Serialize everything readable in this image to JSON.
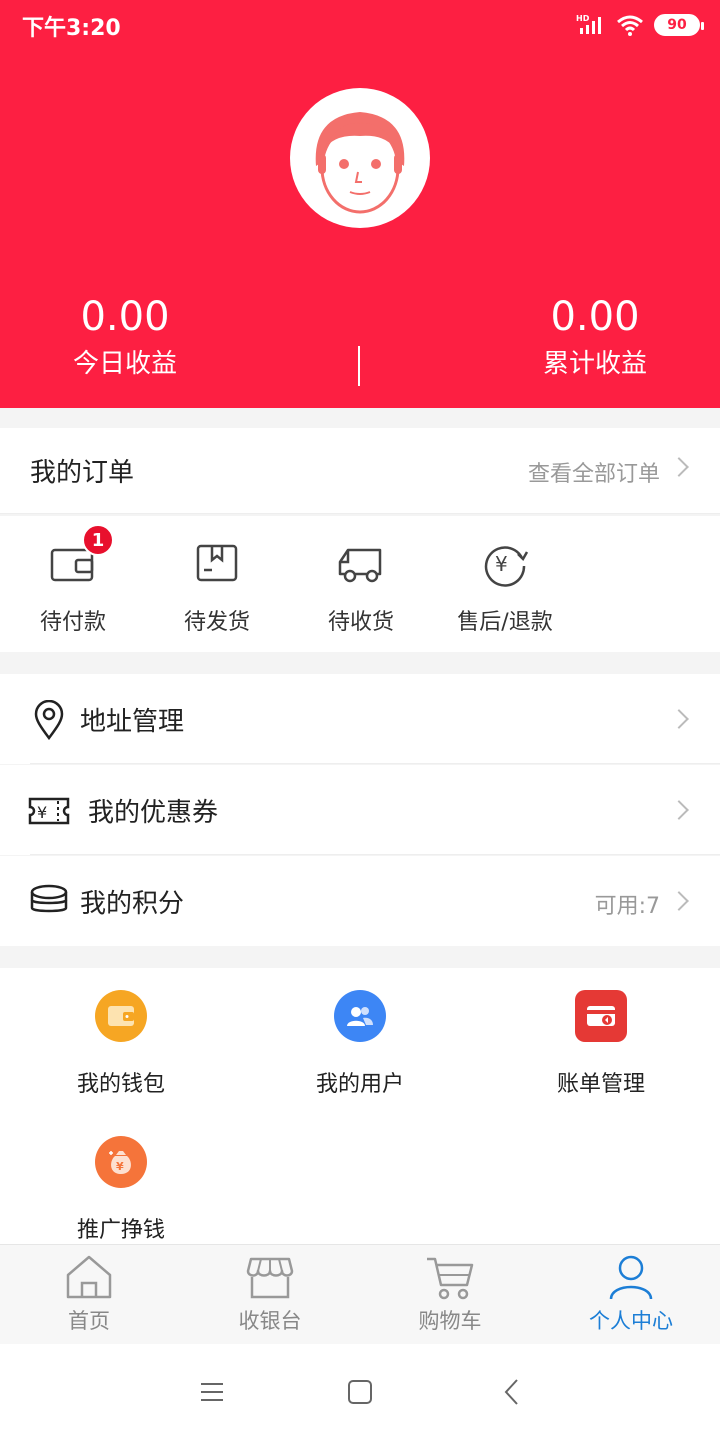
{
  "status": {
    "time": "下午3:20",
    "battery": "90",
    "network": "HD"
  },
  "stats": {
    "today_value": "0.00",
    "today_label": "今日收益",
    "total_value": "0.00",
    "total_label": "累计收益"
  },
  "orders": {
    "title": "我的订单",
    "view_all": "查看全部订单",
    "items": [
      {
        "label": "待付款",
        "icon": "wallet-icon",
        "badge": "1"
      },
      {
        "label": "待发货",
        "icon": "package-icon"
      },
      {
        "label": "待收货",
        "icon": "truck-icon"
      },
      {
        "label": "售后/退款",
        "icon": "refund-icon"
      }
    ]
  },
  "list": [
    {
      "label": "地址管理",
      "icon": "location-pin-icon",
      "value": ""
    },
    {
      "label": "我的优惠券",
      "icon": "coupon-icon",
      "value": ""
    },
    {
      "label": "我的积分",
      "icon": "coins-icon",
      "value": "可用:7"
    }
  ],
  "grid": [
    {
      "label": "我的钱包",
      "icon": "wallet-circle-icon",
      "color": "#f6a623"
    },
    {
      "label": "我的用户",
      "icon": "users-icon",
      "color": "#3d86f5"
    },
    {
      "label": "账单管理",
      "icon": "bill-icon",
      "color": "#e53935"
    },
    {
      "label": "推广挣钱",
      "icon": "money-bag-icon",
      "color": "#f5743a"
    }
  ],
  "tabs": [
    {
      "label": "首页",
      "icon": "home-icon"
    },
    {
      "label": "收银台",
      "icon": "store-icon"
    },
    {
      "label": "购物车",
      "icon": "cart-icon"
    },
    {
      "label": "个人中心",
      "icon": "person-icon",
      "active": true
    }
  ],
  "colors": {
    "brand_red": "#fd1f42",
    "active_blue": "#1c7ed6"
  }
}
